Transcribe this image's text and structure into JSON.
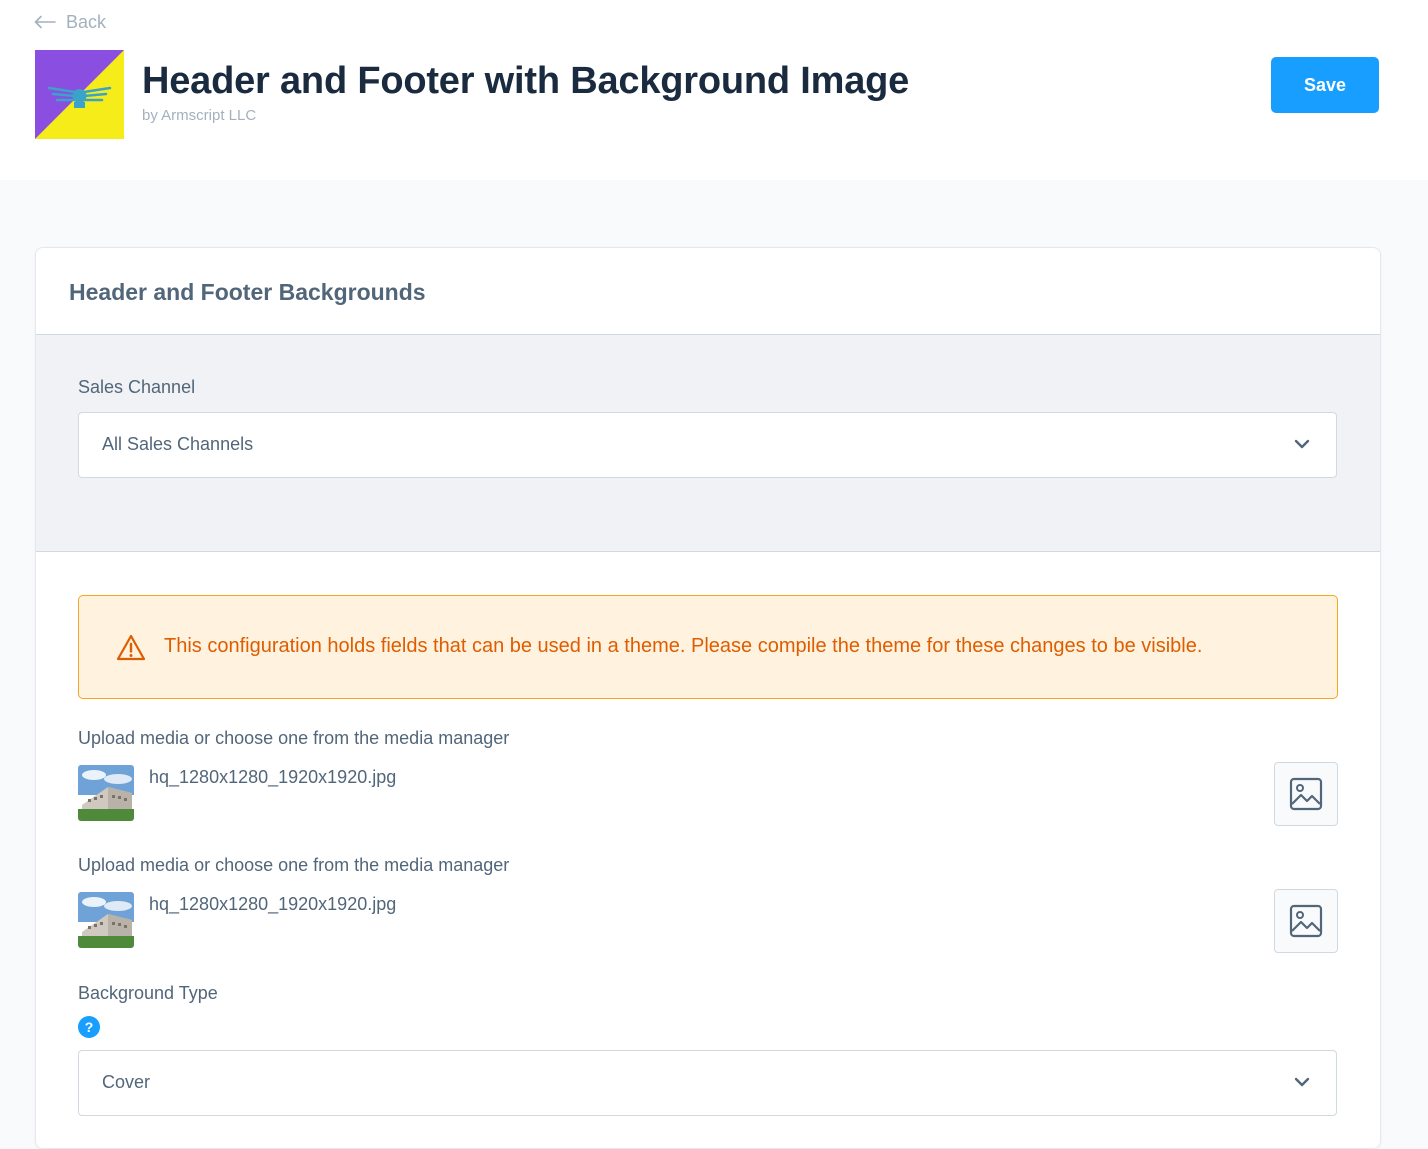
{
  "header": {
    "back_label": "Back",
    "title": "Header and Footer with Background Image",
    "subtitle": "by Armscript LLC",
    "save_label": "Save"
  },
  "card": {
    "title": "Header and Footer Backgrounds",
    "sales_channel": {
      "label": "Sales Channel",
      "value": "All Sales Channels"
    },
    "alert": {
      "text": "This configuration holds fields that can be used in a theme. Please compile the theme for these changes to be visible."
    },
    "media_fields": [
      {
        "label": "Upload media or choose one from the media manager",
        "filename": "hq_1280x1280_1920x1920.jpg"
      },
      {
        "label": "Upload media or choose one from the media manager",
        "filename": "hq_1280x1280_1920x1920.jpg"
      }
    ],
    "background_type": {
      "label": "Background Type",
      "help_glyph": "?",
      "value": "Cover"
    }
  },
  "colors": {
    "accent": "#189eff",
    "title": "#1a2a3f",
    "text": "#52667a",
    "warning_bg": "#fff3e0",
    "warning_border": "#f5a623",
    "warning_text": "#de5d00"
  },
  "icons": [
    "arrow-left-icon",
    "warning-icon",
    "image-icon",
    "chevron-down-icon",
    "help-icon"
  ]
}
